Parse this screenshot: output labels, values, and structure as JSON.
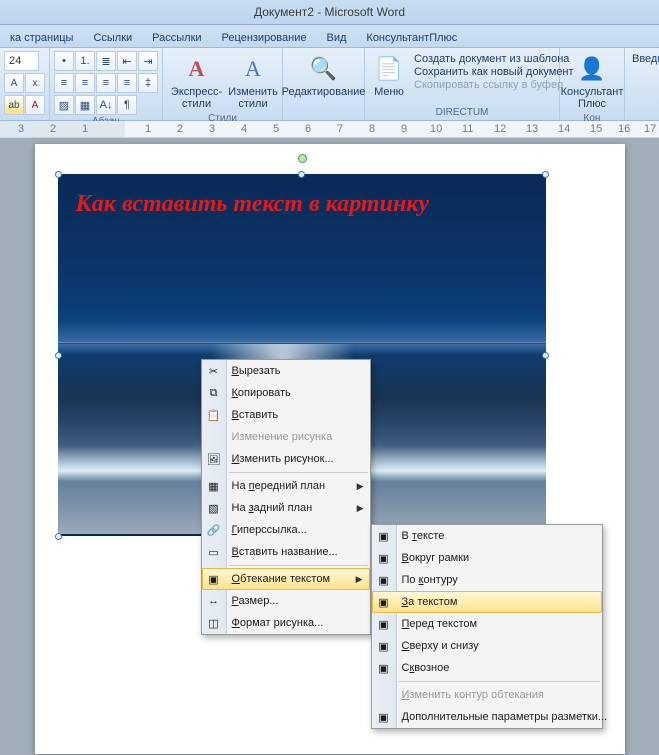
{
  "window": {
    "title": "Документ2 - Microsoft Word"
  },
  "tabs": [
    "ка страницы",
    "Ссылки",
    "Рассылки",
    "Рецензирование",
    "Вид",
    "КонсультантПлюс"
  ],
  "ribbon": {
    "font_size": "24",
    "group_para": "Абзац",
    "group_styles": "Стили",
    "styles_express": "Экспресс-стили",
    "styles_change": "Изменить\nстили",
    "group_edit": "Редактирование",
    "menu_label": "Меню",
    "links": {
      "l1": "Создать документ из шаблона",
      "l2": "Сохранить как новый документ",
      "l3": "Скопировать ссылку в буфер"
    },
    "group_directum": "DIRECTUM",
    "konsult": "Консультант\nПлюс",
    "vvedit": "Введит",
    "kon": "Кон"
  },
  "ruler_marks": [
    "3",
    "2",
    "1",
    "",
    "1",
    "2",
    "3",
    "4",
    "5",
    "6",
    "7",
    "8",
    "9",
    "10",
    "11",
    "12",
    "13",
    "14",
    "15",
    "16",
    "17"
  ],
  "image_text": "Как вставить текст в картинку",
  "context_menu": {
    "items": [
      {
        "key": "cut",
        "label": "Вырезать",
        "u": "В",
        "icon": "✂"
      },
      {
        "key": "copy",
        "label": "Копировать",
        "u": "К",
        "icon": "⧉"
      },
      {
        "key": "paste",
        "label": "Вставить",
        "u": "В",
        "icon": "📋"
      },
      {
        "key": "editpic",
        "label": "Изменение рисунка",
        "disabled": true
      },
      {
        "key": "changepic",
        "label": "Изменить рисунок...",
        "u": "И",
        "icon": "🖼"
      },
      {
        "sep": true
      },
      {
        "key": "front",
        "label": "На передний план",
        "u": "п",
        "icon": "▦",
        "sub": true
      },
      {
        "key": "back",
        "label": "На задний план",
        "u": "з",
        "icon": "▧",
        "sub": true
      },
      {
        "key": "hyper",
        "label": "Гиперссылка...",
        "u": "Г",
        "icon": "🔗"
      },
      {
        "key": "caption",
        "label": "Вставить название...",
        "u": "В",
        "icon": "▭"
      },
      {
        "sep": true
      },
      {
        "key": "wrap",
        "label": "Обтекание текстом",
        "u": "О",
        "icon": "▣",
        "sub": true,
        "hl": true
      },
      {
        "key": "size",
        "label": "Размер...",
        "u": "Р",
        "icon": "↔"
      },
      {
        "key": "format",
        "label": "Формат рисунка...",
        "u": "Ф",
        "icon": "◫"
      }
    ]
  },
  "wrap_submenu": {
    "items": [
      {
        "key": "inline",
        "label": "В тексте",
        "u": "т",
        "icon": "▣"
      },
      {
        "key": "square",
        "label": "Вокруг рамки",
        "u": "В",
        "icon": "▣"
      },
      {
        "key": "tight",
        "label": "По контуру",
        "u": "к",
        "icon": "▣"
      },
      {
        "key": "behind",
        "label": "За текстом",
        "u": "З",
        "icon": "▣",
        "hl": true
      },
      {
        "key": "front",
        "label": "Перед текстом",
        "u": "П",
        "icon": "▣"
      },
      {
        "key": "topbot",
        "label": "Сверху и снизу",
        "u": "С",
        "icon": "▣"
      },
      {
        "key": "through",
        "label": "Сквозное",
        "u": "к",
        "icon": "▣"
      },
      {
        "sep": true
      },
      {
        "key": "editwrap",
        "label": "Изменить контур обтекания",
        "u": "И",
        "disabled": true
      },
      {
        "key": "more",
        "label": "Дополнительные параметры разметки...",
        "u": "Д",
        "icon": "▣"
      }
    ]
  }
}
